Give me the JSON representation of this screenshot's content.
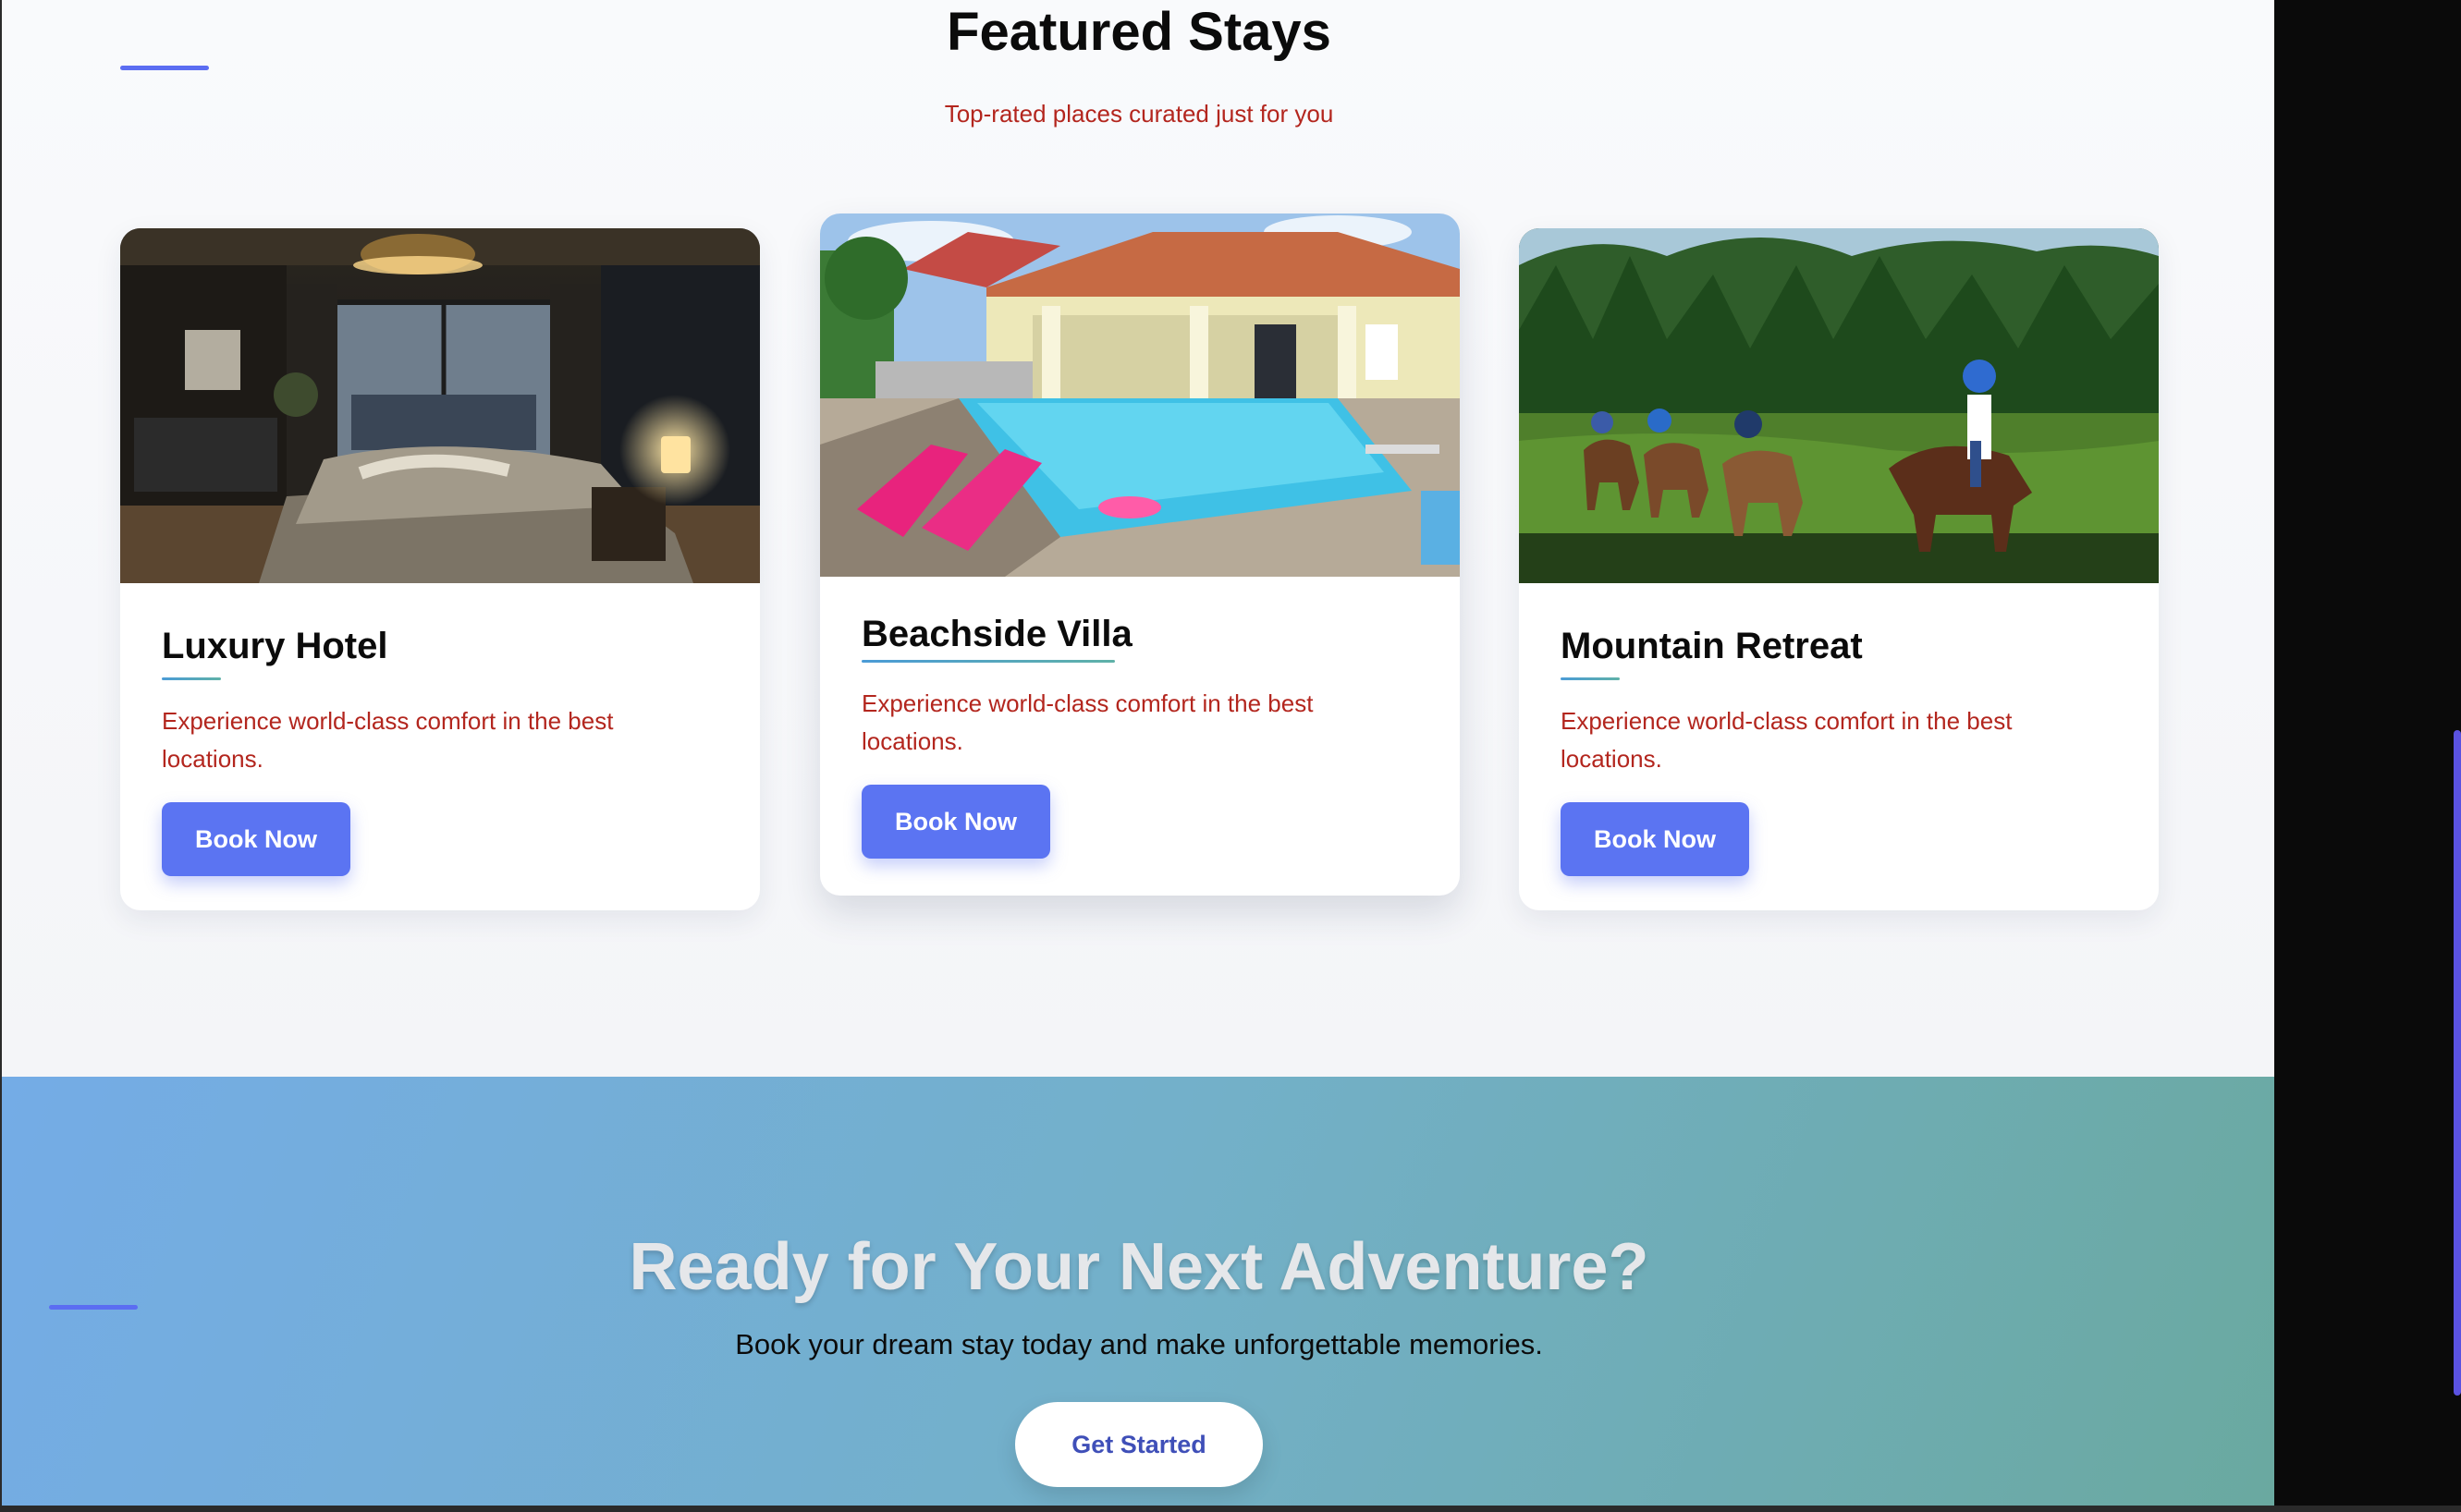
{
  "featured": {
    "title": "Featured Stays",
    "subtitle": "Top-rated places curated just for you"
  },
  "cards": [
    {
      "title": "Luxury Hotel",
      "description": "Experience world-class comfort in the best locations.",
      "button": "Book Now",
      "image": "luxury-bedroom-photo"
    },
    {
      "title": "Beachside Villa",
      "description": "Experience world-class comfort in the best locations.",
      "button": "Book Now",
      "image": "villa-pool-photo"
    },
    {
      "title": "Mountain Retreat",
      "description": "Experience world-class comfort in the best locations.",
      "button": "Book Now",
      "image": "horseback-riding-forest-photo"
    }
  ],
  "cta": {
    "title": "Ready for Your Next Adventure?",
    "subtitle": "Book your dream stay today and make unforgettable memories.",
    "button": "Get Started"
  },
  "colors": {
    "accent": "#5b74f2",
    "description_text": "#b3261e",
    "cta_gradient_start": "#74ace6",
    "cta_gradient_end": "#6aa9a0"
  }
}
